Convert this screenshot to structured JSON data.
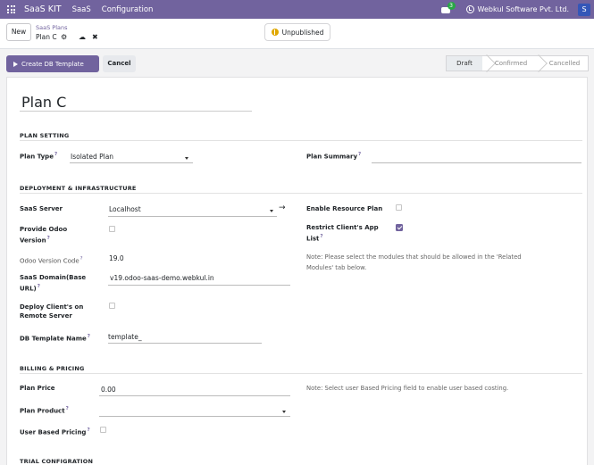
{
  "navbar": {
    "app_name": "SaaS KIT",
    "menus": [
      "SaaS",
      "Configuration"
    ],
    "message_count": "3",
    "company": "Webkul Software Pvt. Ltd.",
    "avatar_letter": "S"
  },
  "control_panel": {
    "new_label": "New",
    "breadcrumb_parent": "SaaS Plans",
    "breadcrumb_current": "Plan C",
    "publish_label": "Unpublished"
  },
  "actions": {
    "create_label": "Create DB Template",
    "cancel_label": "Cancel",
    "statuses": [
      "Draft",
      "Confirmed",
      "Cancelled"
    ],
    "active_status": "Draft"
  },
  "form": {
    "title": "Plan C",
    "plan_setting": {
      "heading": "PLAN SETTING",
      "plan_type_label": "Plan Type",
      "plan_type_value": "Isolated Plan",
      "plan_summary_label": "Plan Summary",
      "plan_summary_value": ""
    },
    "deployment": {
      "heading": "DEPLOYMENT & INFRASTRUCTURE",
      "saas_server_label": "SaaS Server",
      "saas_server_value": "Localhost",
      "provide_odoo_label_1": "Provide Odoo",
      "provide_odoo_label_2": "Version",
      "provide_odoo_checked": false,
      "odoo_version_code_label": "Odoo Version Code",
      "odoo_version_code_value": "19.0",
      "saas_domain_label_1": "SaaS Domain(Base",
      "saas_domain_label_2": "URL)",
      "saas_domain_value": "v19.odoo-saas-demo.webkul.in",
      "deploy_remote_label_1": "Deploy Client's on",
      "deploy_remote_label_2": "Remote Server",
      "deploy_remote_checked": false,
      "db_template_label": "DB Template Name",
      "db_template_value": "template_",
      "enable_resource_label": "Enable Resource Plan",
      "enable_resource_checked": false,
      "restrict_apps_label_1": "Restrict Client's App",
      "restrict_apps_label_2": "List",
      "restrict_apps_checked": true,
      "restrict_note_1": "Note: Please select the modules that should be allowed in the 'Related",
      "restrict_note_2": "Modules' tab below."
    },
    "billing": {
      "heading": "BILLING & PRICING",
      "plan_price_label": "Plan Price",
      "plan_price_value": "0.00",
      "plan_product_label": "Plan Product",
      "plan_product_value": "",
      "user_based_label": "User Based Pricing",
      "user_based_checked": false,
      "billing_note": "Note: Select user Based Pricing field to enable user based costing."
    },
    "trial": {
      "heading": "TRIAL CONFIGRATION"
    }
  },
  "colors": {
    "brand": "#71639e",
    "page_bg": "#f3f3f4"
  }
}
